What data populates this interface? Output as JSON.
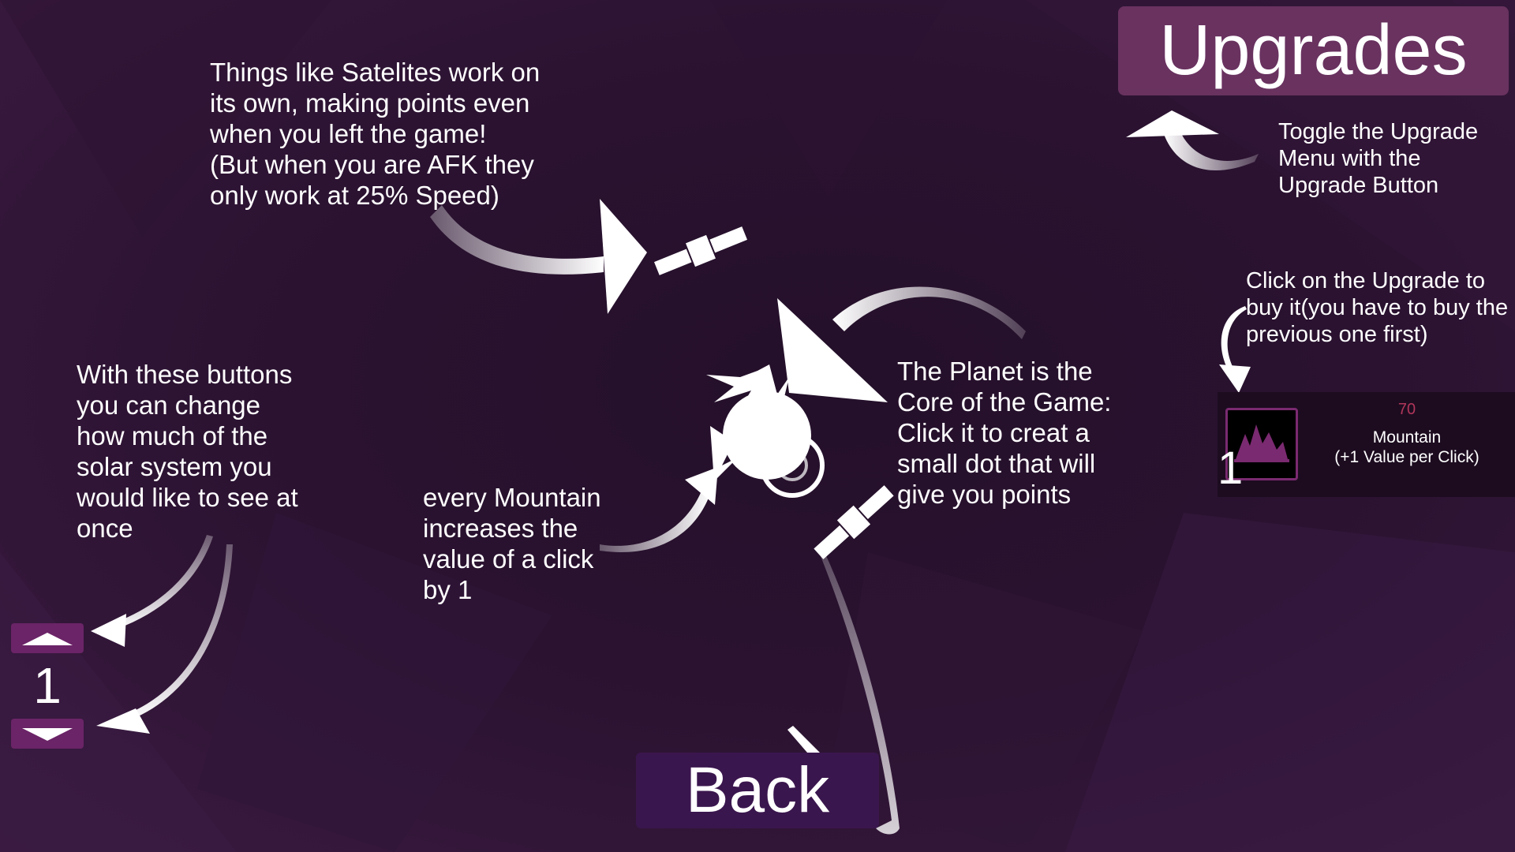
{
  "tips": {
    "satellites": "Things like Satelites work on\nits own, making points even\nwhen you left the game!\n(But when you are AFK they\nonly work at 25% Speed)",
    "toggle_upgrades": "Toggle the Upgrade\nMenu with the\nUpgrade Button",
    "buy_upgrade": "Click on the Upgrade to\nbuy it(you have to buy the\nprevious one first)",
    "planet": "The Planet is the\nCore of the Game:\nClick it to creat a\nsmall dot that will\ngive you points",
    "zoom_buttons": "With these buttons\nyou can change\nhow much of the\nsolar system you\nwould like to see at\nonce",
    "mountain": "every Mountain\nincreases the\nvalue of a click\nby 1"
  },
  "upgrades_button": {
    "label": "Upgrades"
  },
  "back_button": {
    "label": "Back"
  },
  "zoom": {
    "value": "1",
    "up_icon": "chevron-up-icon",
    "down_icon": "chevron-down-icon"
  },
  "upgrade_item": {
    "cost": "70",
    "name": "Mountain\n(+1 Value per Click)",
    "owned": "1",
    "icon": "mountain-icon"
  },
  "colors": {
    "background": "#2a1230",
    "button_purple": "#69325f",
    "back_button": "#3a164e",
    "zoom_button": "#6b2467",
    "cost_text": "#b0365a"
  }
}
